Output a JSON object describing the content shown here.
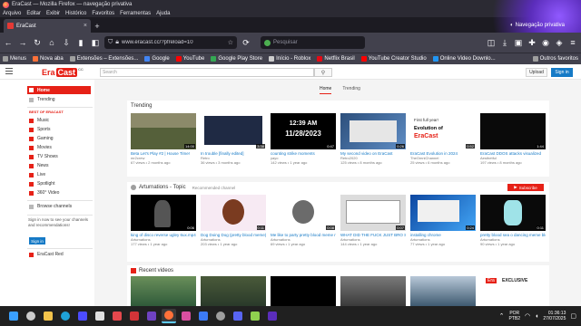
{
  "window": {
    "title": "EraCast — Mozilla Firefox — navegação privativa"
  },
  "menu": [
    "Arquivo",
    "Editar",
    "Exibir",
    "Histórico",
    "Favoritos",
    "Ferramentas",
    "Ajuda"
  ],
  "tab": {
    "title": "EraCast",
    "close": "×",
    "new": "+"
  },
  "private": {
    "label": "Navegação privativa"
  },
  "nav": {
    "url": "www.eracast.cc/?pfreload=10",
    "search_placeholder": "Pesquisar"
  },
  "bookmarks": {
    "items": [
      {
        "label": "Menus",
        "color": "#9e9e9e"
      },
      {
        "label": "Nova aba",
        "color": "#ff7139"
      },
      {
        "label": "Extensões – Extensões...",
        "color": "#9e9e9e"
      },
      {
        "label": "Google",
        "color": "#4285f4"
      },
      {
        "label": "YouTube",
        "color": "#ff0000"
      },
      {
        "label": "Google Play Store",
        "color": "#34a853"
      },
      {
        "label": "Início - Roblox",
        "color": "#cccccc"
      },
      {
        "label": "Netflix Brasil",
        "color": "#e50914"
      },
      {
        "label": "YouTube Creator Studio",
        "color": "#ff0000"
      },
      {
        "label": "Online Video Downlo...",
        "color": "#2196f3"
      }
    ],
    "other": "Outros favoritos"
  },
  "site": {
    "logo_text": "Era",
    "logo_box": "Cast",
    "logo_cc": "CC",
    "search_placeholder": "Search",
    "upload": "Upload",
    "signin": "Sign in",
    "tabs": [
      "Home",
      "Trending"
    ]
  },
  "guide": {
    "top": [
      "Home",
      "Trending"
    ],
    "best_header": "BEST OF ERACAST",
    "best": [
      "Music",
      "Sports",
      "Gaming",
      "Movies",
      "TV Shows",
      "News",
      "Live",
      "Spotlight",
      "360° Video"
    ],
    "browse": "Browse channels",
    "signin_text": "Sign in now to see your channels and recommendations!",
    "signin_btn": "Sign in",
    "red": "EraCast Red"
  },
  "sections": {
    "trending": {
      "title": "Trending",
      "videos": [
        {
          "title": "Beta Let's Play #2 | House Time!",
          "author": "mr2crew",
          "meta": "67 views • 2 months ago",
          "dur": "14:00",
          "color": "#6a6a55"
        },
        {
          "title": "In trouble [finally edited]",
          "author": "Retro",
          "meta": "36 views • 3 months ago",
          "dur": "3:38",
          "color": "#1f2a44"
        },
        {
          "title": "counting strike moments",
          "author": "yayo",
          "meta": "142 views • 1 year ago",
          "dur": "0:47",
          "color": "#000000"
        },
        {
          "title": "My second video on EraCast",
          "author": "Retro2020",
          "meta": "125 views • 8 months ago",
          "dur": "0:26",
          "color": "#3f6ea8"
        },
        {
          "title": "EraCast Evolution in 2024",
          "author": "TheOmniChannel",
          "meta": "25 views • 6 months ago",
          "dur": "0:52",
          "color": "#ffffff"
        },
        {
          "title": "EraCast DDOS attacks visualized",
          "author": "Aesthetful",
          "meta": "197 views • 8 months ago",
          "dur": "1:44",
          "color": "#0a0a0a"
        }
      ],
      "texts": {
        "time": "12:39 AM",
        "date": "11/28/2023",
        "evo_title": "First full year!",
        "evo_sub": "Evolution of",
        "evo_brand": "EraCast"
      }
    },
    "channel": {
      "title": "Arturnations - Topic",
      "sub": "Recommended channel",
      "subscribe": "Subscribe",
      "videos": [
        {
          "title": "king of disco reverse ugley 6ux.mp4",
          "author": "Arturnations",
          "meta": "177 views • 1 year ago",
          "dur": "0:06",
          "color": "#000000"
        },
        {
          "title": "Dog Doing Dog (pretty blood meme) (f...",
          "author": "Arturnations",
          "meta": "203 views • 1 year ago",
          "dur": "0:11",
          "color": "#f7eaf3"
        },
        {
          "title": "Me like to party pretty blood meme ror...",
          "author": "Arturnations",
          "meta": "69 views • 1 year ago",
          "dur": "0:08",
          "color": "#ffffff"
        },
        {
          "title": "WHAT DID THE FUCK JUST BRO SAID?",
          "author": "Arturnations",
          "meta": "144 views • 1 year ago",
          "dur": "0:07",
          "color": "#dcdcdc"
        },
        {
          "title": "installing chrome",
          "author": "Arturnations",
          "meta": "77 views • 1 year ago",
          "dur": "0:24",
          "color": "#1a66c7"
        },
        {
          "title": "pretty blood sea o dancing meme bloom...",
          "author": "Arturnations",
          "meta": "90 views • 1 year ago",
          "dur": "0:11",
          "color": "#0a0a0a"
        }
      ]
    },
    "recent": {
      "title": "Recent videos",
      "badge": "Era",
      "exclusive": "EXCLUSIVE",
      "thumbs": [
        "#2f5a3a",
        "#2a3a2a",
        "#000000",
        "#4a4a4a",
        "#3e5a70",
        "#ffffff"
      ]
    }
  },
  "taskbar": {
    "apps": [
      {
        "name": "windows",
        "color": "#3aa0ff"
      },
      {
        "name": "search",
        "color": "#cccccc"
      },
      {
        "name": "explorer",
        "color": "#f3c34b"
      },
      {
        "name": "edge",
        "color": "#1fa2d8"
      },
      {
        "name": "store",
        "color": "#4c4cff"
      },
      {
        "name": "mail",
        "color": "#e0e0e0"
      },
      {
        "name": "media",
        "color": "#e5484d"
      },
      {
        "name": "red-app",
        "color": "#d13438"
      },
      {
        "name": "vsc",
        "color": "#6f42c1"
      },
      {
        "name": "firefox",
        "color": "#ff7139"
      },
      {
        "name": "pink-app",
        "color": "#d94fa0"
      },
      {
        "name": "vpn",
        "color": "#3c7bf6"
      },
      {
        "name": "settings",
        "color": "#9e9e9e"
      },
      {
        "name": "discord",
        "color": "#5865f2"
      },
      {
        "name": "terminal",
        "color": "#8fd14f"
      },
      {
        "name": "browser-private",
        "color": "#5b2dbb"
      }
    ],
    "lang": "POR",
    "lang2": "PTB2",
    "time": "01:36:13",
    "date": "27/07/2025"
  }
}
